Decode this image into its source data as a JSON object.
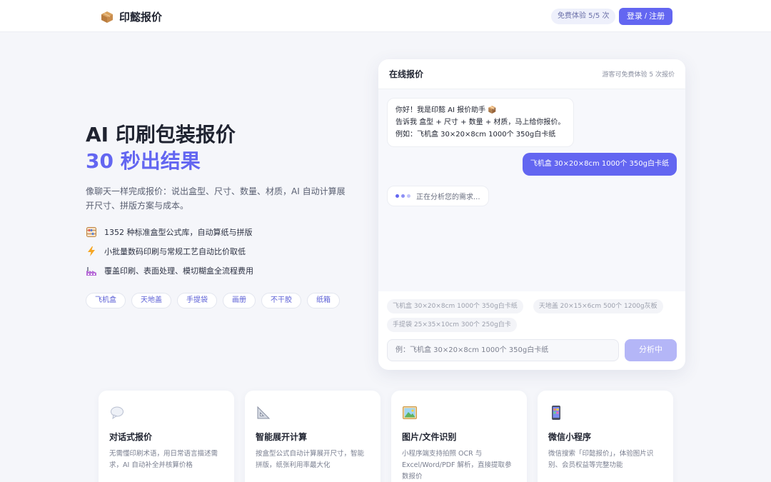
{
  "header": {
    "brand": "印懿报价",
    "quota_badge": "免费体验 5/5 次",
    "login_button": "登录 / 注册"
  },
  "hero": {
    "title_line1": "AI 印刷包装报价",
    "title_line2": "30 秒出结果",
    "description": "像聊天一样完成报价：说出盒型、尺寸、数量、材质，AI 自动计算展开尺寸、拼版方案与成本。",
    "features": [
      {
        "icon": "abacus-icon",
        "text": "1352 种标准盒型公式库，自动算纸与拼版"
      },
      {
        "icon": "lightning-icon",
        "text": "小批量数码印刷与常规工艺自动比价取低"
      },
      {
        "icon": "factory-icon",
        "text": "覆盖印刷、表面处理、模切糊盒全流程费用"
      }
    ],
    "tags": [
      "飞机盒",
      "天地盖",
      "手提袋",
      "画册",
      "不干胶",
      "纸箱"
    ]
  },
  "chat": {
    "title": "在线报价",
    "guest_note": "游客可免费体验 5 次报价",
    "bot_greeting": [
      "你好！我是印懿 AI 报价助手 📦",
      "告诉我 盒型 + 尺寸 + 数量 + 材质，马上给你报价。",
      "例如：飞机盒 30×20×8cm 1000个 350g白卡纸"
    ],
    "user_message": "飞机盒 30×20×8cm 1000个 350g白卡纸",
    "typing_text": "正在分析您的需求...",
    "suggestions": [
      "飞机盒 30×20×8cm 1000个 350g白卡纸",
      "天地盖 20×15×6cm 500个 1200g灰板",
      "手提袋 25×35×10cm 300个 250g白卡"
    ],
    "input_placeholder": "例：飞机盒 30×20×8cm 1000个 350g白卡纸",
    "send_button": "分析中"
  },
  "features_cards": [
    {
      "icon": "speech-bubble-icon",
      "title": "对话式报价",
      "desc": "无需懂印刷术语，用日常语言描述需求，AI 自动补全并核算价格"
    },
    {
      "icon": "ruler-triangle-icon",
      "title": "智能展开计算",
      "desc": "按盒型公式自动计算展开尺寸，智能拼版，纸张利用率最大化"
    },
    {
      "icon": "picture-icon",
      "title": "图片/文件识别",
      "desc": "小程序端支持拍照 OCR 与 Excel/Word/PDF 解析，直接提取参数报价"
    },
    {
      "icon": "mobile-phone-icon",
      "title": "微信小程序",
      "desc": "微信搜索「印懿报价」，体验图片识别、会员权益等完整功能"
    }
  ],
  "colors": {
    "accent": "#6366f1",
    "accent_light": "#b4b6f7",
    "background": "#f5f6fa"
  }
}
